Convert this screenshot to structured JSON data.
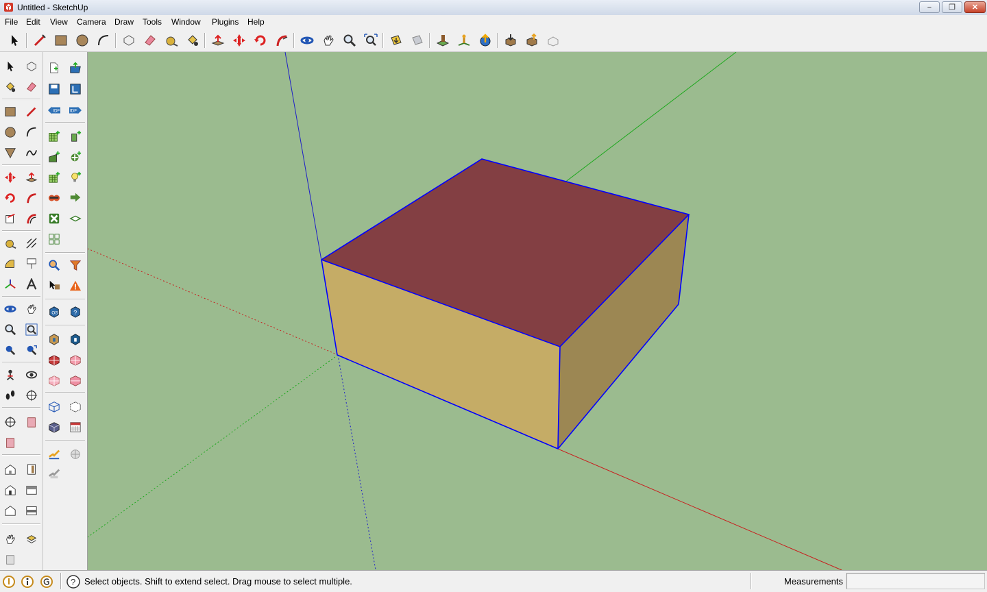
{
  "window": {
    "title": "Untitled - SketchUp",
    "minimize_label": "−",
    "restore_label": "❐",
    "close_label": "✕"
  },
  "menu": [
    "File",
    "Edit",
    "View",
    "Camera",
    "Draw",
    "Tools",
    "Window",
    "Plugins",
    "Help"
  ],
  "toolbar_icons": [
    "select-icon",
    "line-icon",
    "rectangle-icon",
    "circle-icon",
    "arc-icon",
    "make-component-icon",
    "eraser-icon",
    "tape-measure-icon",
    "paint-bucket-icon",
    "push-pull-icon",
    "move-icon",
    "rotate-icon",
    "follow-me-icon",
    "orbit-icon",
    "pan-icon",
    "zoom-icon",
    "zoom-extents-icon",
    "get-models-icon",
    "share-model-icon",
    "add-location-icon",
    "toggle-terrain-icon",
    "google-earth-icon",
    "get-models-2-icon",
    "share-component-icon",
    "preview-earth-icon"
  ],
  "status": {
    "hint": "Select objects. Shift to extend select. Drag mouse to select multiple.",
    "measurements_label": "Measurements",
    "measurements_value": ""
  },
  "colors": {
    "viewport_bg": "#9bbb8f",
    "top_face": "#833f43",
    "front_face": "#c5ac66",
    "side_face": "#9c8753",
    "edge": "#0000ff",
    "axis_red": "#c81e1e",
    "axis_green": "#1ea81e",
    "axis_blue": "#1e1ec8"
  }
}
